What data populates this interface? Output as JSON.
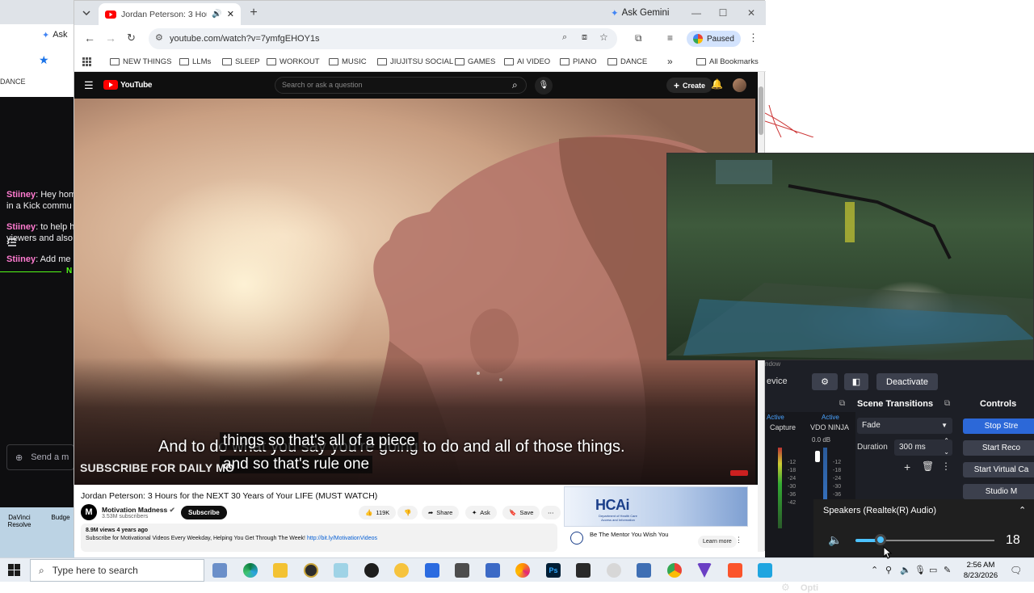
{
  "background_window": {
    "ask_label": "Ask",
    "bookmark_dance": "DANCE",
    "chat_banner_text": "N",
    "chat": [
      {
        "user": "Stiiney",
        "text": ": Hey hom",
        "text2": "in a Kick commu"
      },
      {
        "user": "Stiiney",
        "text": ": to help h",
        "text2": "viewers and also"
      },
      {
        "user": "Stiiney",
        "text": ": Add me",
        "text2": ""
      }
    ],
    "send_placeholder": "Send a m",
    "desktop_icons": [
      "DaVinci Resolve",
      "Budge"
    ]
  },
  "chrome": {
    "tab_title": "Jordan Peterson: 3 Hours fo",
    "ask_gemini": "Ask Gemini",
    "url": "youtube.com/watch?v=7ymfgEHOY1s",
    "profile_status": "Paused",
    "bookmarks": [
      "NEW THINGS",
      "LLMs",
      "SLEEP",
      "WORKOUT",
      "MUSIC",
      "JIUJITSU SOCIAL",
      "GAMES",
      "AI VIDEO",
      "PIANO",
      "DANCE"
    ],
    "all_bookmarks": "All Bookmarks",
    "overflow": "»"
  },
  "youtube": {
    "logo_text": "YouTube",
    "search_placeholder": "Search or ask a question",
    "create_label": "Create",
    "captions": {
      "line_back": "And to do what you say you're going to do and all of those things.",
      "line_front_1": "things so that's all of a piece",
      "line_front_2": "and so that's rule one"
    },
    "watermark": "SUBSCRIBE FOR DAILY MO",
    "title": "Jordan Peterson: 3 Hours for the NEXT 30 Years of Your LIFE (MUST WATCH)",
    "channel": "Motivation Madness",
    "subscribers": "3.53M subscribers",
    "subscribe": "Subscribe",
    "likes": "119K",
    "share": "Share",
    "ask": "Ask",
    "save": "Save",
    "views_age": "8.9M views  4 years ago",
    "description": "Subscribe for Motivational Videos Every Weekday, Helping You Get Through The Week!",
    "description_link": "http://bit.ly/MotivationVideos",
    "ad": {
      "logo": "HCAi",
      "logo_sub": "Department of Health Care Access and Information",
      "text": "Be The Mentor You Wish You",
      "cta": "Learn more"
    }
  },
  "obs": {
    "device_label": "evice",
    "deactivate": "Deactivate",
    "scene_transitions_title": "Scene Transitions",
    "controls_title": "Controls",
    "active_1": "Active",
    "active_2": "Active",
    "capture_label": "Capture",
    "source_label": "VDO NINJA",
    "db_label": "0.0 dB",
    "transition": "Fade",
    "duration_label": "Duration",
    "duration_value": "300 ms",
    "meter_ticks": [
      "-12",
      "-18",
      "-24",
      "-30",
      "-36",
      "-42"
    ],
    "controls": [
      "Stop Stre",
      "Start Reco",
      "Start Virtual Ca",
      "Studio M"
    ],
    "options_label": "Opti",
    "window_label": "ndow"
  },
  "volume": {
    "device": "Speakers (Realtek(R) Audio)",
    "value": "18",
    "level": 0.18
  },
  "taskbar": {
    "search_placeholder": "Type here to search",
    "time": "2:56 AM",
    "date": "8/23/2026"
  }
}
